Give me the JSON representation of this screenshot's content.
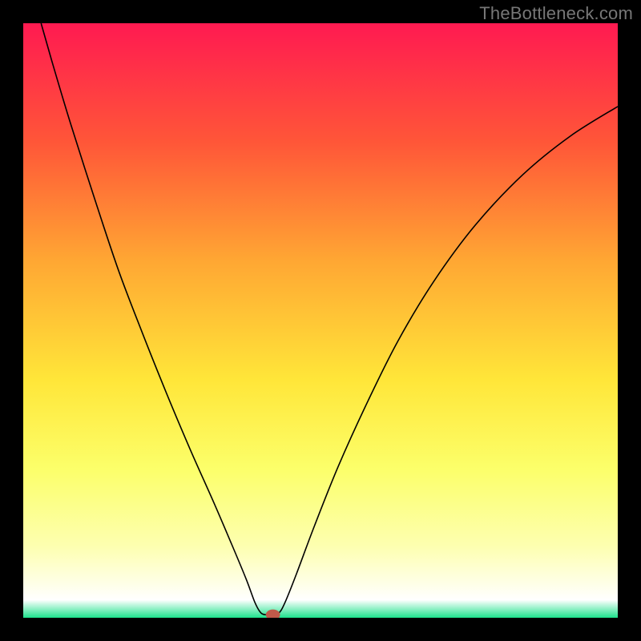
{
  "watermark": "TheBottleneck.com",
  "chart_data": {
    "type": "line",
    "title": "",
    "xlabel": "",
    "ylabel": "",
    "xlim": [
      0,
      100
    ],
    "ylim": [
      0,
      100
    ],
    "background_gradient": {
      "stops": [
        {
          "offset": 0.0,
          "color": "#ff1a51"
        },
        {
          "offset": 0.2,
          "color": "#ff5638"
        },
        {
          "offset": 0.4,
          "color": "#ffa733"
        },
        {
          "offset": 0.6,
          "color": "#ffe639"
        },
        {
          "offset": 0.75,
          "color": "#fcff6a"
        },
        {
          "offset": 0.88,
          "color": "#fdffb0"
        },
        {
          "offset": 0.97,
          "color": "#ffffff"
        },
        {
          "offset": 1.0,
          "color": "#1de28c"
        }
      ]
    },
    "series": [
      {
        "name": "bottleneck-curve",
        "color": "#000000",
        "points": [
          {
            "x": 3.0,
            "y": 100.0
          },
          {
            "x": 5.0,
            "y": 93.0
          },
          {
            "x": 8.0,
            "y": 83.0
          },
          {
            "x": 12.0,
            "y": 70.5
          },
          {
            "x": 16.0,
            "y": 58.5
          },
          {
            "x": 20.0,
            "y": 48.0
          },
          {
            "x": 24.0,
            "y": 38.0
          },
          {
            "x": 28.0,
            "y": 28.5
          },
          {
            "x": 32.0,
            "y": 19.5
          },
          {
            "x": 35.0,
            "y": 12.5
          },
          {
            "x": 37.5,
            "y": 6.5
          },
          {
            "x": 39.0,
            "y": 2.5
          },
          {
            "x": 40.0,
            "y": 0.8
          },
          {
            "x": 41.0,
            "y": 0.5
          },
          {
            "x": 42.0,
            "y": 0.5
          },
          {
            "x": 43.0,
            "y": 0.8
          },
          {
            "x": 44.0,
            "y": 2.5
          },
          {
            "x": 46.0,
            "y": 7.5
          },
          {
            "x": 49.0,
            "y": 15.5
          },
          {
            "x": 53.0,
            "y": 25.5
          },
          {
            "x": 58.0,
            "y": 36.5
          },
          {
            "x": 63.0,
            "y": 46.5
          },
          {
            "x": 69.0,
            "y": 56.5
          },
          {
            "x": 76.0,
            "y": 66.0
          },
          {
            "x": 84.0,
            "y": 74.5
          },
          {
            "x": 92.0,
            "y": 81.0
          },
          {
            "x": 100.0,
            "y": 86.0
          }
        ]
      }
    ],
    "marker": {
      "x": 42.0,
      "y": 0.5,
      "color": "#c05a4a",
      "rx": 1.2,
      "ry": 0.9
    }
  }
}
